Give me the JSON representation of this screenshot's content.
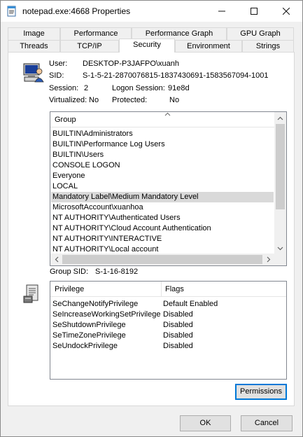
{
  "window": {
    "title": "notepad.exe:4668 Properties",
    "icons": {
      "app": "notepad-app-icon",
      "minimize": "minimize-icon",
      "maximize": "maximize-icon",
      "close": "close-icon"
    }
  },
  "tabs": {
    "row1": [
      "Image",
      "Performance",
      "Performance Graph",
      "GPU Graph"
    ],
    "row2": [
      "Threads",
      "TCP/IP",
      "Security",
      "Environment",
      "Strings"
    ],
    "active": "Security"
  },
  "security": {
    "user_label": "User:",
    "user_value": "DESKTOP-P3JAFPO\\xuanh",
    "sid_label": "SID:",
    "sid_value": "S-1-5-21-2870076815-1837430691-1583567094-1001",
    "session_label": "Session:",
    "session_value": "2",
    "logon_session_label": "Logon Session:",
    "logon_session_value": "91e8d",
    "virtualized_label": "Virtualized:",
    "virtualized_value": "No",
    "protected_label": "Protected:",
    "protected_value": "No",
    "groups_header": "Group",
    "groups": [
      "BUILTIN\\Administrators",
      "BUILTIN\\Performance Log Users",
      "BUILTIN\\Users",
      "CONSOLE LOGON",
      "Everyone",
      "LOCAL",
      "Mandatory Label\\Medium Mandatory Level",
      "MicrosoftAccount\\xuanhoa",
      "NT AUTHORITY\\Authenticated Users",
      "NT AUTHORITY\\Cloud Account Authentication",
      "NT AUTHORITY\\INTERACTIVE",
      "NT AUTHORITY\\Local account"
    ],
    "selected_group": "Mandatory Label\\Medium Mandatory Level",
    "group_sid_label": "Group SID:",
    "group_sid_value": "S-1-16-8192",
    "privileges_header": "Privilege",
    "flags_header": "Flags",
    "privileges": [
      {
        "name": "SeChangeNotifyPrivilege",
        "flags": "Default Enabled"
      },
      {
        "name": "SeIncreaseWorkingSetPrivilege",
        "flags": "Disabled"
      },
      {
        "name": "SeShutdownPrivilege",
        "flags": "Disabled"
      },
      {
        "name": "SeTimeZonePrivilege",
        "flags": "Disabled"
      },
      {
        "name": "SeUndockPrivilege",
        "flags": "Disabled"
      }
    ],
    "permissions_button": "Permissions",
    "user_icon": "user-computer-icon",
    "privilege_icon": "privilege-document-icon"
  },
  "footer": {
    "ok": "OK",
    "cancel": "Cancel"
  }
}
